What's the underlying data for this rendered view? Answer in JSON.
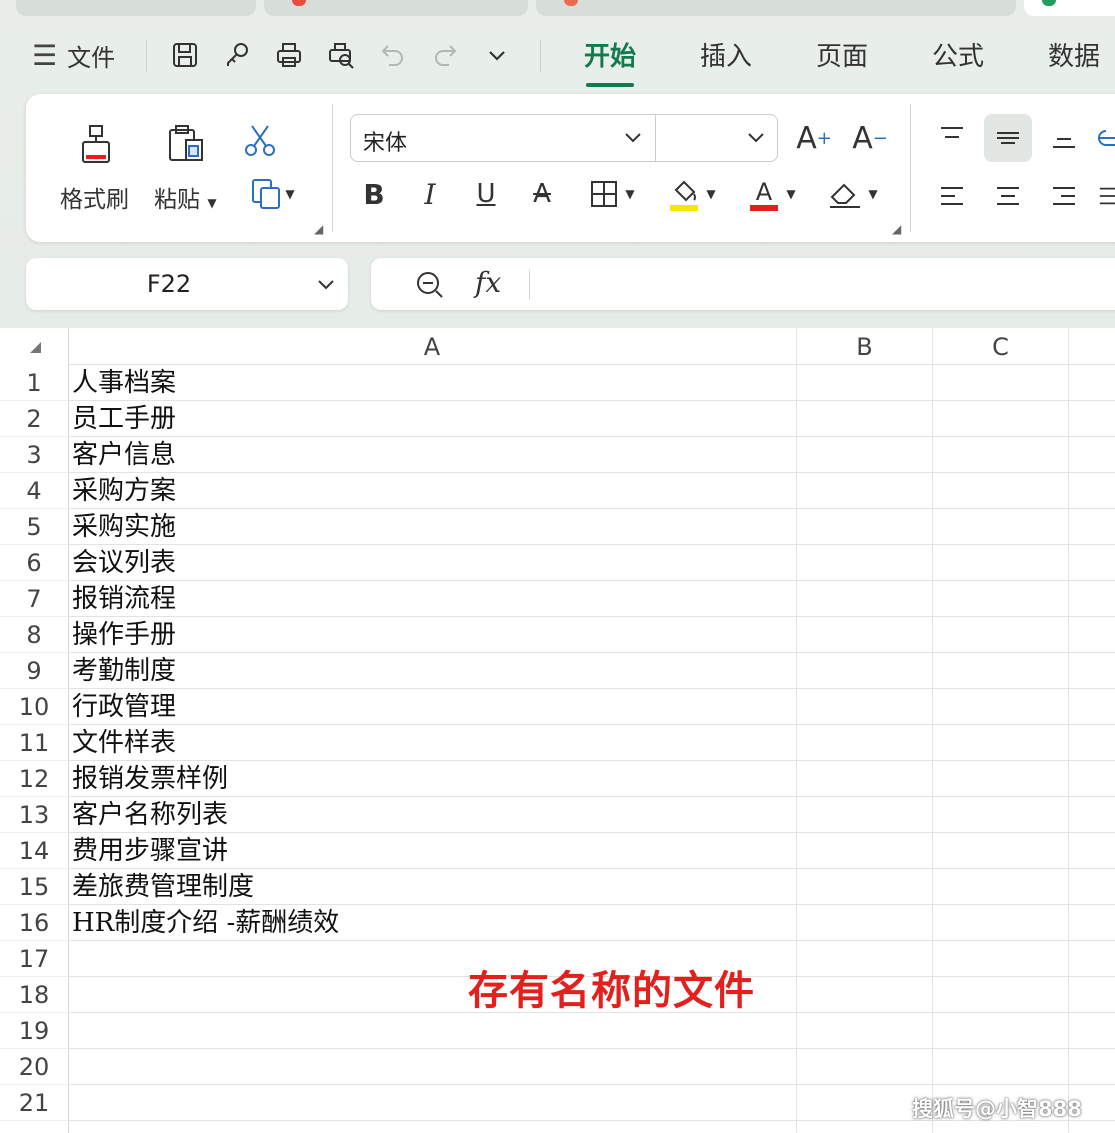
{
  "colors": {
    "accent": "#127a4d",
    "highlight_yellow": "#f7e600",
    "font_red": "#e3201b",
    "annotation_red": "#e3201b",
    "band_bg": "#e9eee9"
  },
  "menu": {
    "file_label": "文件",
    "quick_icons": [
      "save-icon",
      "key-icon",
      "print-icon",
      "print-preview-icon",
      "undo-icon",
      "redo-icon",
      "more-chevron-icon"
    ]
  },
  "ribbon_tabs": [
    "开始",
    "插入",
    "页面",
    "公式",
    "数据"
  ],
  "ribbon": {
    "format_painter_label": "格式刷",
    "paste_label": "粘贴",
    "font_name": "宋体",
    "font_size": "",
    "icons": {
      "cut": "scissors-icon",
      "copy": "copy-icon",
      "grow_font": "font-grow-icon",
      "shrink_font": "font-shrink-icon",
      "bold": "B",
      "italic": "I",
      "underline": "U",
      "strikethrough": "A"
    }
  },
  "name_box": {
    "value": "F22"
  },
  "formula_bar": {
    "fx_label": "fx",
    "content": ""
  },
  "sheet": {
    "columns": [
      "A",
      "B",
      "C"
    ],
    "rows": [
      {
        "n": "1",
        "a": "人事档案"
      },
      {
        "n": "2",
        "a": "员工手册"
      },
      {
        "n": "3",
        "a": "客户信息"
      },
      {
        "n": "4",
        "a": "采购方案"
      },
      {
        "n": "5",
        "a": "采购实施"
      },
      {
        "n": "6",
        "a": "会议列表"
      },
      {
        "n": "7",
        "a": "报销流程"
      },
      {
        "n": "8",
        "a": "操作手册"
      },
      {
        "n": "9",
        "a": "考勤制度"
      },
      {
        "n": "10",
        "a": "行政管理"
      },
      {
        "n": "11",
        "a": "文件样表"
      },
      {
        "n": "12",
        "a": "报销发票样例"
      },
      {
        "n": "13",
        "a": "客户名称列表"
      },
      {
        "n": "14",
        "a": "费用步骤宣讲"
      },
      {
        "n": "15",
        "a": "差旅费管理制度"
      },
      {
        "n": "16",
        "a": "HR制度介绍 -薪酬绩效"
      },
      {
        "n": "17",
        "a": ""
      },
      {
        "n": "18",
        "a": ""
      },
      {
        "n": "19",
        "a": ""
      },
      {
        "n": "20",
        "a": ""
      },
      {
        "n": "21",
        "a": ""
      }
    ]
  },
  "annotation": "存有名称的文件",
  "watermark": "搜狐号@小智888"
}
